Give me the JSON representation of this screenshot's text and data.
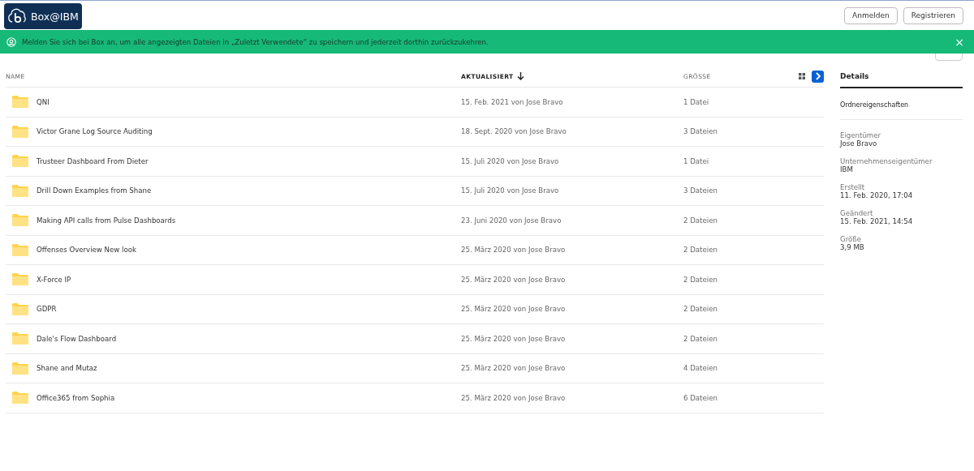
{
  "header": {
    "logo": "Box@IBM",
    "buttons": [
      "Anmelden",
      "Registrieren"
    ]
  },
  "banner": {
    "message": "Melden Sie sich bei Box an, um alle angezeigten Dateien in „Zuletzt Verwendete“ zu speichern und jederzeit dorthin zurückzukehren.",
    "close": "×"
  },
  "table": {
    "columns": [
      {
        "label": "NAME",
        "sorted": false
      },
      {
        "label": "AKTUALISIERT",
        "sorted": true
      },
      {
        "label": "GRÖSSE",
        "sorted": false
      }
    ],
    "details_open": true,
    "rows": [
      {
        "name": "QNI",
        "updated": "15. Feb. 2021 von Jose Bravo",
        "size": "1 Datei"
      },
      {
        "name": "Victor Grane Log Source Auditing",
        "updated": "18. Sept. 2020 von Jose Bravo",
        "size": "3 Dateien"
      },
      {
        "name": "Trusteer Dashboard From Dieter",
        "updated": "15. Juli 2020 von Jose Bravo",
        "size": "1 Datei"
      },
      {
        "name": "Drill Down Examples from Shane",
        "updated": "15. Juli 2020 von Jose Bravo",
        "size": "3 Dateien"
      },
      {
        "name": "Making API calls from Pulse Dashboards",
        "updated": "23. Juni 2020 von Jose Bravo",
        "size": "2 Dateien"
      },
      {
        "name": "Offenses Overview New look",
        "updated": "25. März 2020 von Jose Bravo",
        "size": "2 Dateien"
      },
      {
        "name": "X-Force IP",
        "updated": "25. März 2020 von Jose Bravo",
        "size": "2 Dateien"
      },
      {
        "name": "GDPR",
        "updated": "25. März 2020 von Jose Bravo",
        "size": "2 Dateien"
      },
      {
        "name": "Dale's Flow Dashboard",
        "updated": "25. März 2020 von Jose Bravo",
        "size": "2 Dateien"
      },
      {
        "name": "Shane and Mutaz",
        "updated": "25. März 2020 von Jose Bravo",
        "size": "4 Dateien"
      },
      {
        "name": "Office365 from Sophia",
        "updated": "25. März 2020 von Jose Bravo",
        "size": "6 Dateien"
      }
    ]
  },
  "sidebar": {
    "tab": "Details",
    "section": "Ordnereigenschaften",
    "properties": [
      {
        "label": "Eigentümer",
        "value": "Jose Bravo"
      },
      {
        "label": "Unternehmenseigentümer",
        "value": "IBM"
      },
      {
        "label": "Erstellt",
        "value": "11. Feb. 2020, 17:04"
      },
      {
        "label": "Geändert",
        "value": "15. Feb. 2021, 14:54"
      },
      {
        "label": "Größe",
        "value": "3,9 MB"
      }
    ]
  }
}
